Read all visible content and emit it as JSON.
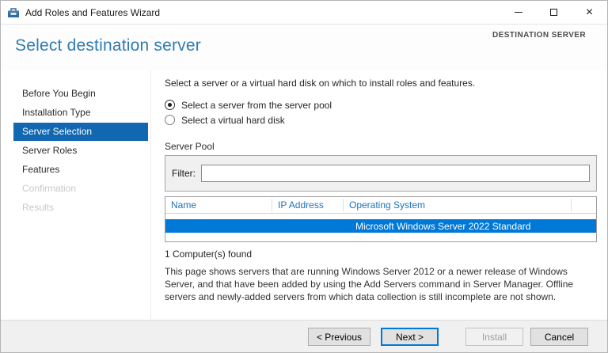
{
  "window": {
    "title": "Add Roles and Features Wizard",
    "controls": [
      "minimize",
      "maximize",
      "close"
    ]
  },
  "header": {
    "title": "Select destination server",
    "context_label": "DESTINATION SERVER"
  },
  "sidebar": {
    "items": [
      {
        "label": "Before You Begin",
        "state": "normal"
      },
      {
        "label": "Installation Type",
        "state": "normal"
      },
      {
        "label": "Server Selection",
        "state": "selected"
      },
      {
        "label": "Server Roles",
        "state": "normal"
      },
      {
        "label": "Features",
        "state": "normal"
      },
      {
        "label": "Confirmation",
        "state": "disabled"
      },
      {
        "label": "Results",
        "state": "disabled"
      }
    ]
  },
  "main": {
    "instruction": "Select a server or a virtual hard disk on which to install roles and features.",
    "radio_options": [
      {
        "label": "Select a server from the server pool",
        "selected": true
      },
      {
        "label": "Select a virtual hard disk",
        "selected": false
      }
    ],
    "server_pool": {
      "label": "Server Pool",
      "filter_label": "Filter:",
      "filter_value": "",
      "filter_placeholder": ""
    },
    "table": {
      "columns": [
        "Name",
        "IP Address",
        "Operating System"
      ],
      "rows": [
        {
          "name": "",
          "ip_address": "",
          "operating_system": "Microsoft Windows Server 2022 Standard",
          "selected": true
        }
      ]
    },
    "result_count": "1 Computer(s) found",
    "description": "This page shows servers that are running Windows Server 2012 or a newer release of Windows Server, and that have been added by using the Add Servers command in Server Manager. Offline servers and newly-added servers from which data collection is still incomplete are not shown."
  },
  "footer": {
    "buttons": [
      {
        "label": "< Previous",
        "style": "normal"
      },
      {
        "label": "Next >",
        "style": "default"
      },
      {
        "label": "Install",
        "style": "disabled"
      },
      {
        "label": "Cancel",
        "style": "normal"
      }
    ]
  },
  "colors": {
    "accent": "#0078d7",
    "sidebar_selected_bg": "#1267b1",
    "heading_text": "#2f7cb3",
    "table_header_text": "#1f72b8",
    "selected_row_bg": "#0078d7",
    "selected_row_text": "#ffffff",
    "footer_bg": "#f0f0f0"
  }
}
